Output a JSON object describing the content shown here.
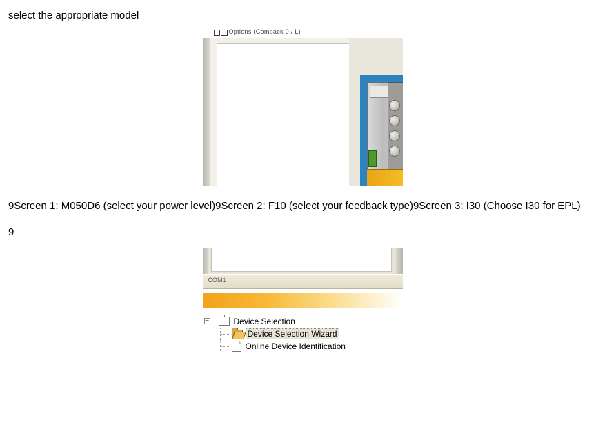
{
  "heading": "select the appropriate model",
  "fig1": {
    "top_caption": "Options (Compack 0 / L)"
  },
  "para1": "9Screen 1: M050D6 (select your power level)9Screen 2: F10 (select your feedback type)9Screen 3: I30 (Choose I30 for EPL)",
  "para2": "9",
  "fig2": {
    "status_label": "COM1",
    "tree": {
      "root": "Device Selection",
      "child1": "Device Selection Wizard",
      "child2": "Online Device Identification"
    }
  }
}
